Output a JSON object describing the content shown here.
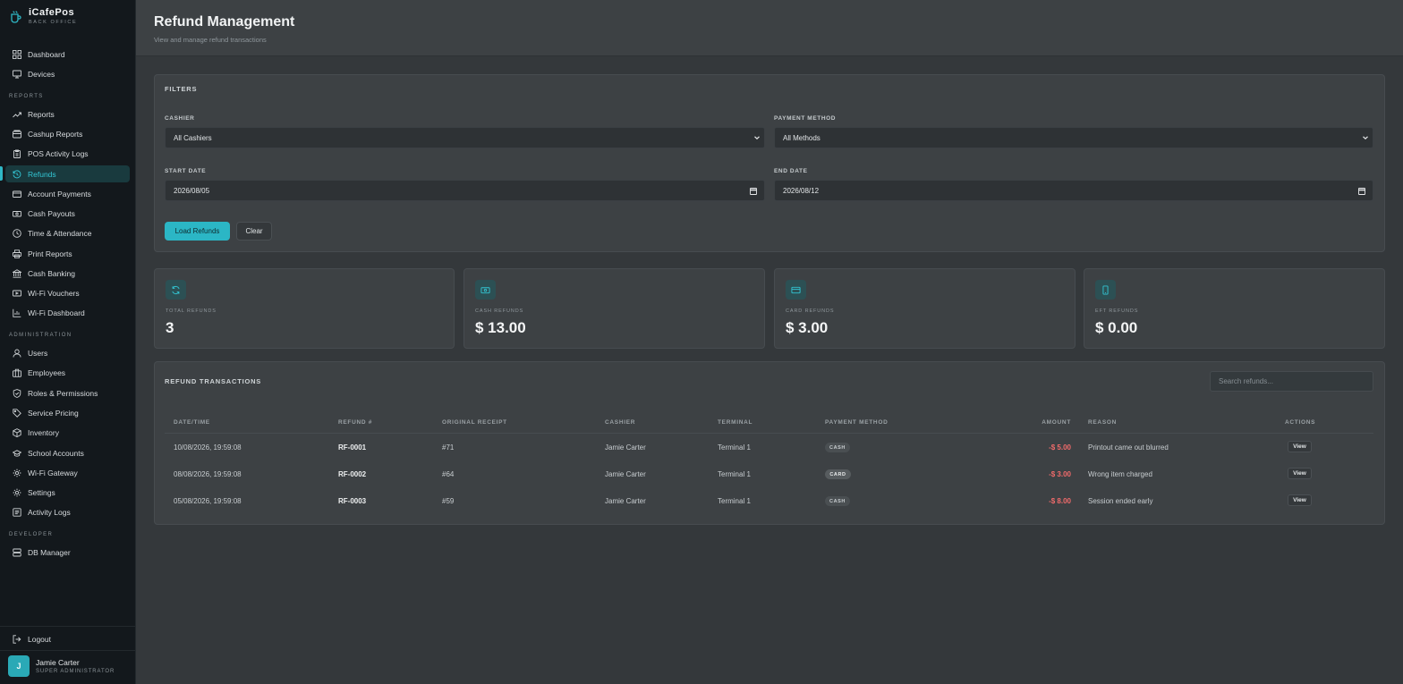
{
  "brand": {
    "name": "iCafePos",
    "sub": "BACK OFFICE"
  },
  "nav": {
    "dashboard": "Dashboard",
    "devices": "Devices",
    "reports_section": "REPORTS",
    "reports": "Reports",
    "cashup": "Cashup Reports",
    "pos_logs": "POS Activity Logs",
    "refunds": "Refunds",
    "account_payments": "Account Payments",
    "cash_payouts": "Cash Payouts",
    "time_attendance": "Time & Attendance",
    "print_reports": "Print Reports",
    "cash_banking": "Cash Banking",
    "wifi_vouchers": "Wi-Fi Vouchers",
    "wifi_dashboard": "Wi-Fi Dashboard",
    "admin_section": "ADMINISTRATION",
    "users": "Users",
    "employees": "Employees",
    "roles": "Roles & Permissions",
    "service_pricing": "Service Pricing",
    "inventory": "Inventory",
    "school_accounts": "School Accounts",
    "wifi_gateway": "Wi-Fi Gateway",
    "settings": "Settings",
    "activity_logs": "Activity Logs",
    "developer_section": "DEVELOPER",
    "db_manager": "DB Manager",
    "logout": "Logout"
  },
  "user": {
    "initial": "J",
    "name": "Jamie Carter",
    "role": "SUPER ADMINISTRATOR"
  },
  "header": {
    "title": "Refund Management",
    "subtitle": "View and manage refund transactions"
  },
  "filters": {
    "title": "FILTERS",
    "cashier_label": "CASHIER",
    "cashier_value": "All Cashiers",
    "payment_label": "PAYMENT METHOD",
    "payment_value": "All Methods",
    "start_label": "START DATE",
    "start_value": "2026/08/05",
    "end_label": "END DATE",
    "end_value": "2026/08/12",
    "load_button": "Load Refunds",
    "clear_button": "Clear"
  },
  "stats": {
    "total_label": "TOTAL REFUNDS",
    "total_value": "3",
    "cash_label": "CASH REFUNDS",
    "cash_value": "$ 13.00",
    "card_label": "CARD REFUNDS",
    "card_value": "$ 3.00",
    "eft_label": "EFT REFUNDS",
    "eft_value": "$ 0.00"
  },
  "transactions": {
    "title": "REFUND TRANSACTIONS",
    "search_placeholder": "Search refunds...",
    "headers": {
      "datetime": "DATE/TIME",
      "refund": "REFUND #",
      "receipt": "ORIGINAL RECEIPT",
      "cashier": "CASHIER",
      "terminal": "TERMINAL",
      "method": "PAYMENT METHOD",
      "amount": "AMOUNT",
      "reason": "REASON",
      "actions": "ACTIONS"
    },
    "rows": [
      {
        "datetime": "10/08/2026, 19:59:08",
        "refund": "RF-0001",
        "receipt": "#71",
        "cashier": "Jamie Carter",
        "terminal": "Terminal 1",
        "method": "CASH",
        "amount": "-$ 5.00",
        "reason": "Printout came out blurred",
        "action": "View"
      },
      {
        "datetime": "08/08/2026, 19:59:08",
        "refund": "RF-0002",
        "receipt": "#64",
        "cashier": "Jamie Carter",
        "terminal": "Terminal 1",
        "method": "CARD",
        "amount": "-$ 3.00",
        "reason": "Wrong item charged",
        "action": "View"
      },
      {
        "datetime": "05/08/2026, 19:59:08",
        "refund": "RF-0003",
        "receipt": "#59",
        "cashier": "Jamie Carter",
        "terminal": "Terminal 1",
        "method": "CASH",
        "amount": "-$ 8.00",
        "reason": "Session ended early",
        "action": "View"
      }
    ]
  },
  "colors": {
    "accent": "#2bb6c5",
    "negative": "#f16b6b",
    "sidebar": "#13181c",
    "background": "#34383b"
  }
}
